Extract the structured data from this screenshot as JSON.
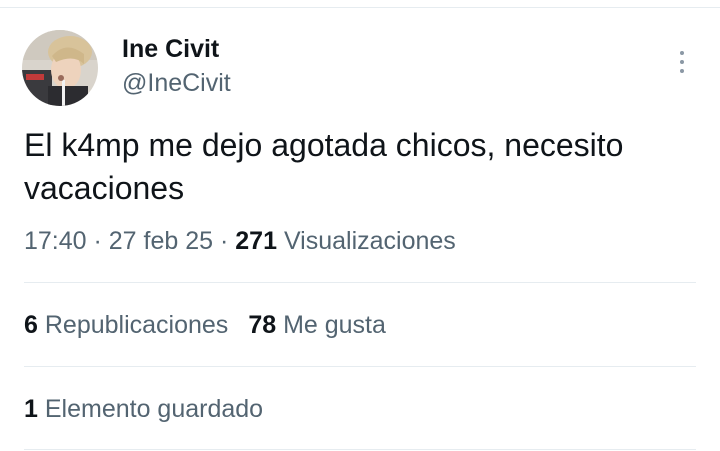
{
  "author": {
    "display_name": "Ine Civit",
    "handle": "@IneCivit",
    "avatar_icon": "profile-photo"
  },
  "more_icon": "more-vertical-icon",
  "tweet": {
    "text_line1": "El k4mp me dejo agotada chicos, necesito",
    "text_line2": "vacaciones"
  },
  "meta": {
    "time": "17:40",
    "separator": " · ",
    "date": "27 feb 25",
    "views_count": "271",
    "views_label": "Visualizaciones"
  },
  "stats": {
    "reposts_count": "6",
    "reposts_label": "Republicaciones",
    "likes_count": "78",
    "likes_label": "Me gusta",
    "bookmarks_count": "1",
    "bookmarks_label": "Elemento guardado"
  },
  "colors": {
    "text_primary": "#0f1419",
    "text_secondary": "#536471",
    "divider": "#e6ecf0"
  }
}
